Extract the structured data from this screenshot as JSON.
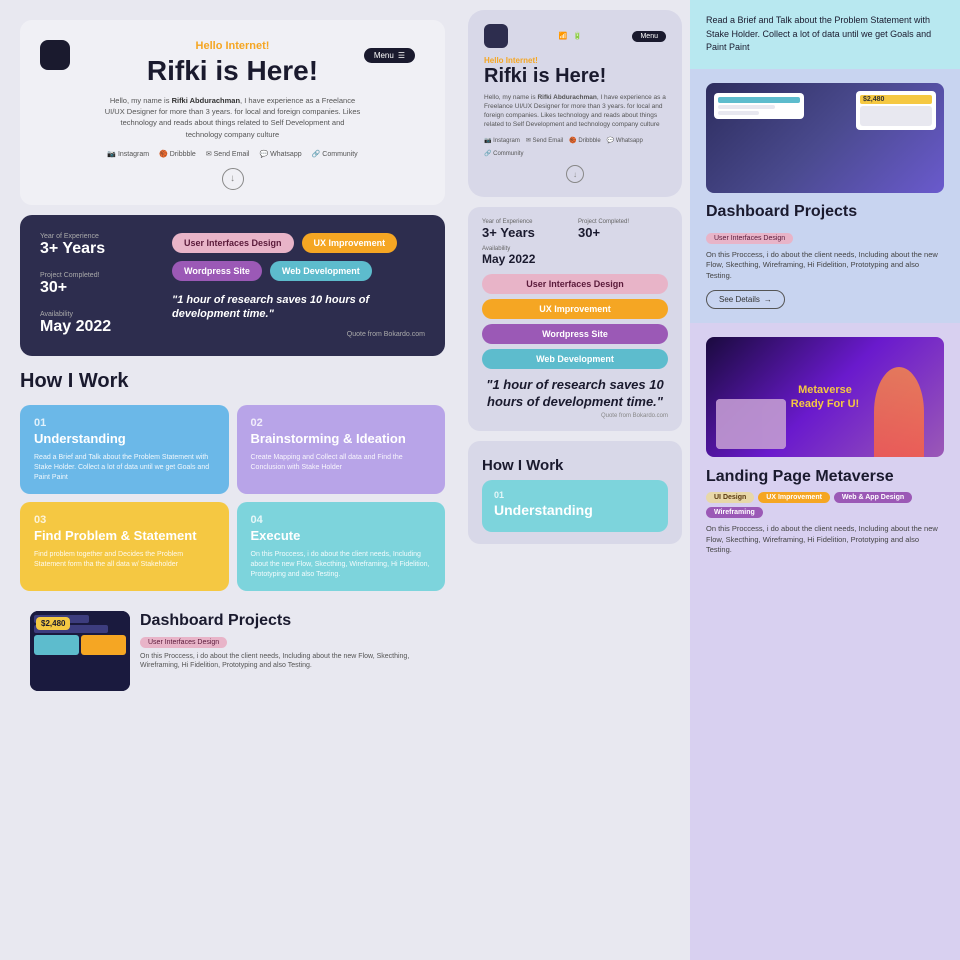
{
  "hero": {
    "hello": "Hello Internet!",
    "title": "Rifki is Here!",
    "desc_prefix": "Hello, my name is ",
    "name_bold": "Rifki Abdurachman",
    "desc_suffix": ", I have experience as a Freelance UI/UX Designer for more than 3 years. for local and foreign companies. Likes technology and reads about things related to Self Development and technology company culture",
    "menu_label": "Menu",
    "scroll_icon": "↓",
    "links": [
      "Instagram",
      "Dribbble",
      "Send Email",
      "Whatsapp",
      "Community"
    ]
  },
  "stats": {
    "experience_label": "Year of Experience",
    "experience_value": "3+ Years",
    "projects_label": "Project Completed!",
    "projects_value": "30+",
    "availability_label": "Availability",
    "availability_value": "May 2022"
  },
  "skills": {
    "btn1": "User Interfaces Design",
    "btn2": "UX Improvement",
    "btn3": "Wordpress Site",
    "btn4": "Web Development"
  },
  "quote": {
    "text": "\"1 hour of research saves 10 hours of development time.\"",
    "source": "Quote from Bokardo.com"
  },
  "how_i_work": {
    "title": "How I Work",
    "steps": [
      {
        "num": "01",
        "name": "Understanding",
        "desc": "Read a Brief and Talk about the Problem Statement with Stake Holder. Collect a lot of data until we get Goals and Paint Paint",
        "color": "blue"
      },
      {
        "num": "02",
        "name": "Brainstorming & Ideation",
        "desc": "Create Mapping and Collect all data and Find the Conclusion with Stake Holder",
        "color": "purple"
      },
      {
        "num": "03",
        "name": "Find Problem & Statement",
        "desc": "Find problem together and Decides the Problem Statement form tha the all data w/ Stakeholder",
        "color": "yellow"
      },
      {
        "num": "04",
        "name": "Execute",
        "desc": "On this Proccess, i do about the client needs, Including about the new Flow, Skecthing, Wireframing, Hi Fidelition, Prototyping and also Testing.",
        "color": "teal"
      }
    ]
  },
  "dashboard_project": {
    "title": "Dashboard Projects",
    "tag": "User Interfaces Design",
    "desc": "On this Proccess, i do about the client needs, Including about the new Flow, Skecthing, Wireframing, Hi Fidelition, Prototyping and also Testing.",
    "see_details": "See Details"
  },
  "dashboard_bottom": {
    "title": "Dashboard Projects",
    "tag": "User Interfaces Design",
    "desc": "On this Proccess, i do about the client needs, Including about the new Flow, Skecthing, Wireframing, Hi Fidelition, Prototyping and also Testing."
  },
  "landing_metaverse": {
    "title": "Landing Page Metaverse",
    "tag1": "UI Design",
    "tag2": "UX Improvement",
    "tag3": "Web & App Design",
    "tag4": "Wireframing",
    "img_title": "Metaverse",
    "img_subtitle": "Ready For U!",
    "desc": "On this Proccess, i do about the client needs, Including about the new Flow, Skecthing, Wireframing, Hi Fidelition, Prototyping and also Testing."
  },
  "top_info": {
    "text": "Read a Brief and Talk about the Problem Statement with Stake Holder. Collect a lot of data until we get Goals and Paint Paint"
  },
  "mobile": {
    "hello": "Hello Internet!",
    "title": "Rifki is Here!",
    "desc_prefix": "Hello, my name is ",
    "name_bold": "Rifki Abdurachman",
    "desc_suffix": ", I have experience as a Freelance UI/UX Designer for more than 3 years. for local and foreign companies. Likes technology and reads about things related to Self Development and technology company culture",
    "links": [
      "Instagram",
      "Send Email",
      "Dribbble",
      "Whatsapp",
      "Community"
    ],
    "experience_label": "Year of Experience",
    "experience_value": "3+ Years",
    "projects_label": "Project Completed!",
    "projects_value": "30+",
    "availability_label": "Availability",
    "availability_value": "May 2022",
    "quote": "\"1 hour of research saves 10 hours of development time.\"",
    "quote_source": "Quote from Bokardo.com",
    "how_title": "How I Work",
    "step_num": "01",
    "step_name": "Understanding"
  },
  "colors": {
    "accent_orange": "#f5a623",
    "accent_teal": "#5dbccd",
    "accent_purple": "#9b59b6",
    "accent_pink": "#e8b4c8",
    "dark_bg": "#2d2d4e",
    "light_bg": "#e8e8f0"
  }
}
